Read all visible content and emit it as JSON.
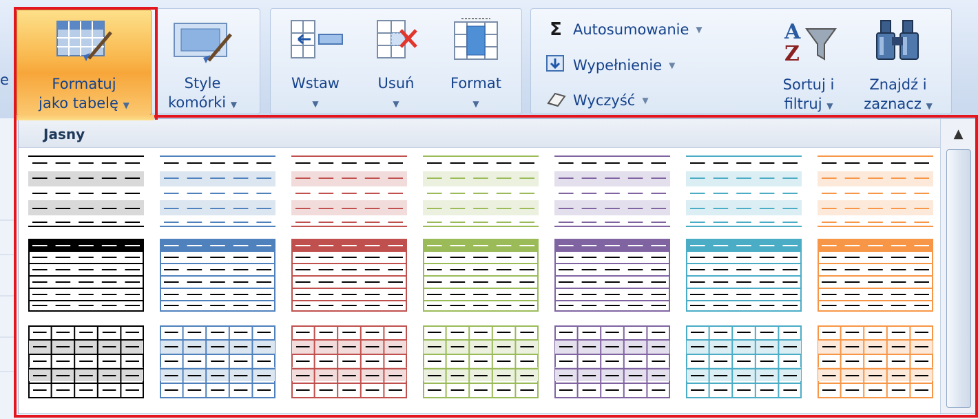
{
  "ribbon": {
    "left_stub": "e",
    "format_as_table": {
      "line1": "Formatuj",
      "line2": "jako tabelę",
      "icon": "table-format-icon"
    },
    "cell_styles": {
      "line1": "Style",
      "line2": "komórki",
      "icon": "cell-styles-icon"
    },
    "insert": {
      "label": "Wstaw",
      "icon": "insert-cells-icon"
    },
    "delete": {
      "label": "Usuń",
      "icon": "delete-cells-icon"
    },
    "format": {
      "label": "Format",
      "icon": "format-cells-icon"
    },
    "autosum": {
      "label": "Autosumowanie",
      "icon": "sigma-icon"
    },
    "fill": {
      "label": "Wypełnienie",
      "icon": "fill-down-icon"
    },
    "clear": {
      "label": "Wyczyść",
      "icon": "eraser-icon"
    },
    "sort_filter": {
      "line1": "Sortuj i",
      "line2": "filtruj",
      "icon": "sort-filter-icon"
    },
    "find_select": {
      "line1": "Znajdź i",
      "line2": "zaznacz",
      "icon": "binoculars-icon"
    }
  },
  "gallery": {
    "section_title": "Jasny",
    "colors": [
      "#000000",
      "#4f81bd",
      "#c0504d",
      "#9bbb59",
      "#8064a2",
      "#4bacc6",
      "#f79646"
    ],
    "light_fills": [
      "#d9d9d9",
      "#dce6f1",
      "#f2dcdb",
      "#ebf1de",
      "#e4dfec",
      "#daeef3",
      "#fde9d9"
    ],
    "rows": [
      {
        "style": "banded-lines"
      },
      {
        "style": "header-bordered"
      },
      {
        "style": "full-grid"
      }
    ]
  },
  "highlight_color": "#e3161f"
}
